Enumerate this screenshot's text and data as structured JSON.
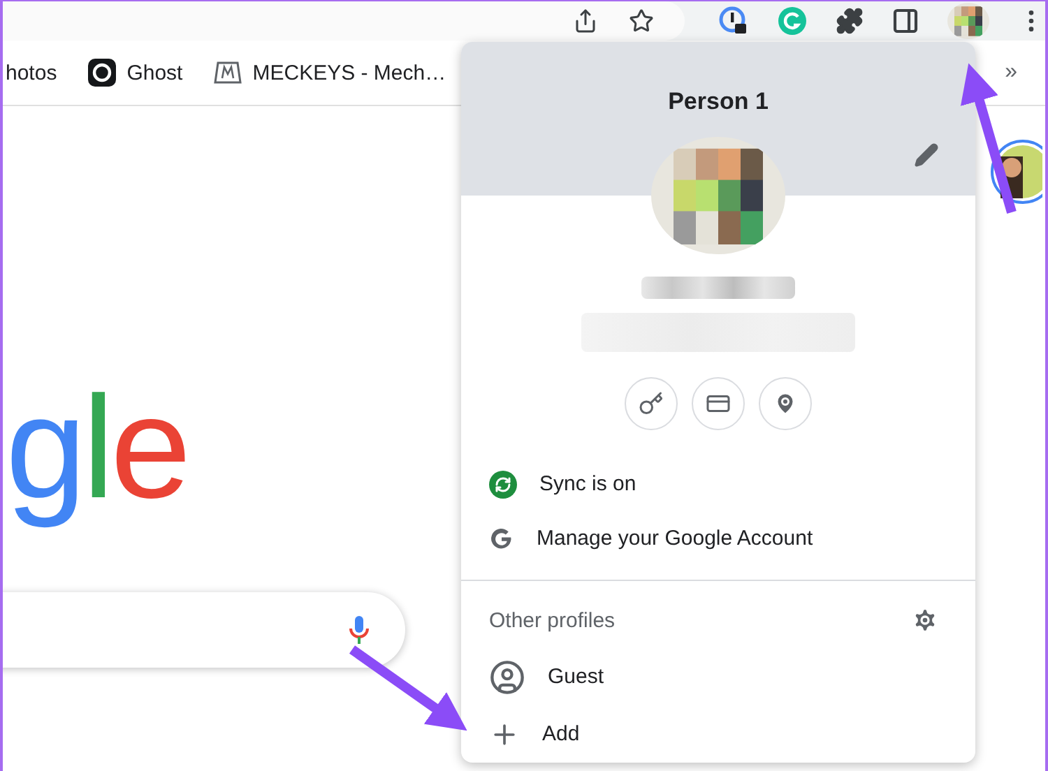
{
  "bookmarks": [
    {
      "label": "hotos",
      "kind": "plain"
    },
    {
      "label": "Ghost",
      "kind": "ghost"
    },
    {
      "label": "MECKEYS - Mech…",
      "kind": "meckeys"
    }
  ],
  "bookmarks_overflow": "»",
  "page": {
    "logo": [
      {
        "letter": "g",
        "color": "#4285f4"
      },
      {
        "letter": "l",
        "color": "#34a853"
      },
      {
        "letter": "e",
        "color": "#ea4335"
      }
    ]
  },
  "profile_menu": {
    "title": "Person 1",
    "shortcuts": [
      {
        "kind": "passwords"
      },
      {
        "kind": "payments"
      },
      {
        "kind": "addresses"
      }
    ],
    "account_items": [
      {
        "kind": "sync",
        "label": "Sync is on"
      },
      {
        "kind": "google",
        "label": "Manage your Google Account"
      }
    ],
    "other_profiles_heading": "Other profiles",
    "profiles": [
      {
        "kind": "guest",
        "label": "Guest"
      },
      {
        "kind": "add",
        "label": "Add"
      }
    ]
  }
}
